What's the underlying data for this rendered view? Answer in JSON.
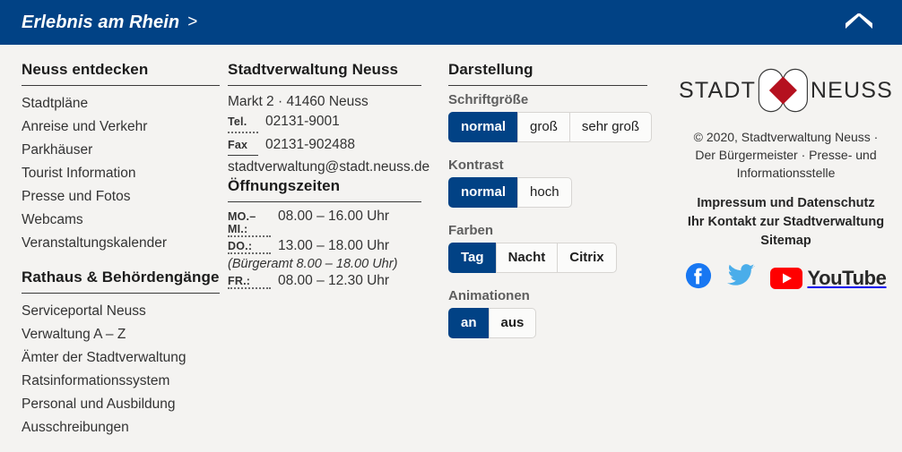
{
  "topbar": {
    "link_label": "Erlebnis am Rhein",
    "caret": ">",
    "collapse_icon": "chevron-up-icon",
    "background_color": "#014285"
  },
  "columns": {
    "discover": {
      "heading": "Neuss entdecken",
      "items": [
        "Stadtpläne",
        "Anreise und Verkehr",
        "Parkhäuser",
        "Tourist Information",
        "Presse und Fotos",
        "Webcams",
        "Veranstaltungskalender"
      ]
    },
    "cityhall": {
      "heading": "Rathaus & Behördengänge",
      "items": [
        "Serviceportal Neuss",
        "Verwaltung A – Z",
        "Ämter der Stadtverwaltung",
        "Ratsinformationssystem",
        "Personal und Ausbildung",
        "Ausschreibungen"
      ]
    },
    "administration": {
      "heading": "Stadtverwaltung Neuss",
      "address": "Markt 2 · 41460 Neuss",
      "tel_label": "Tel.",
      "tel_value": "02131-9001",
      "fax_label": "Fax",
      "fax_value": "02131-902488",
      "email": "stadtverwaltung@stadt.neuss.de",
      "hours_heading": "Öffnungszeiten",
      "hours": [
        {
          "day": "MO.–MI.:",
          "time": "08.00 – 16.00 Uhr",
          "note": ""
        },
        {
          "day": "DO.:",
          "time": "13.00 – 18.00 Uhr",
          "note": "(Bürgeramt 8.00 – 18.00 Uhr)"
        },
        {
          "day": "FR.:",
          "time": "08.00 – 12.30 Uhr",
          "note": ""
        }
      ]
    },
    "display": {
      "heading": "Darstellung",
      "groups": [
        {
          "label": "Schriftgröße",
          "options": [
            "normal",
            "groß",
            "sehr groß"
          ],
          "selected": "normal"
        },
        {
          "label": "Kontrast",
          "options": [
            "normal",
            "hoch"
          ],
          "selected": "normal"
        },
        {
          "label": "Farben",
          "options": [
            "Tag",
            "Nacht",
            "Citrix"
          ],
          "selected": "Tag"
        },
        {
          "label": "Animationen",
          "options": [
            "an",
            "aus"
          ],
          "selected": "an"
        }
      ]
    },
    "brand": {
      "logo_left": "STADT",
      "logo_right": "NEUSS",
      "logo_accent_color": "#b5111f",
      "copyright": "© 2020, Stadtverwaltung Neuss · Der Bürgermeister · Presse- und Informationsstelle",
      "links": [
        "Impressum und Datenschutz",
        "Ihr Kontakt zur Stadtverwaltung",
        "Sitemap"
      ],
      "socials": [
        {
          "name": "facebook-icon",
          "color": "#1877F2"
        },
        {
          "name": "twitter-icon",
          "color": "#4AADEA"
        },
        {
          "name": "youtube-icon",
          "color": "#FF0000",
          "word": "YouTube"
        }
      ]
    }
  }
}
